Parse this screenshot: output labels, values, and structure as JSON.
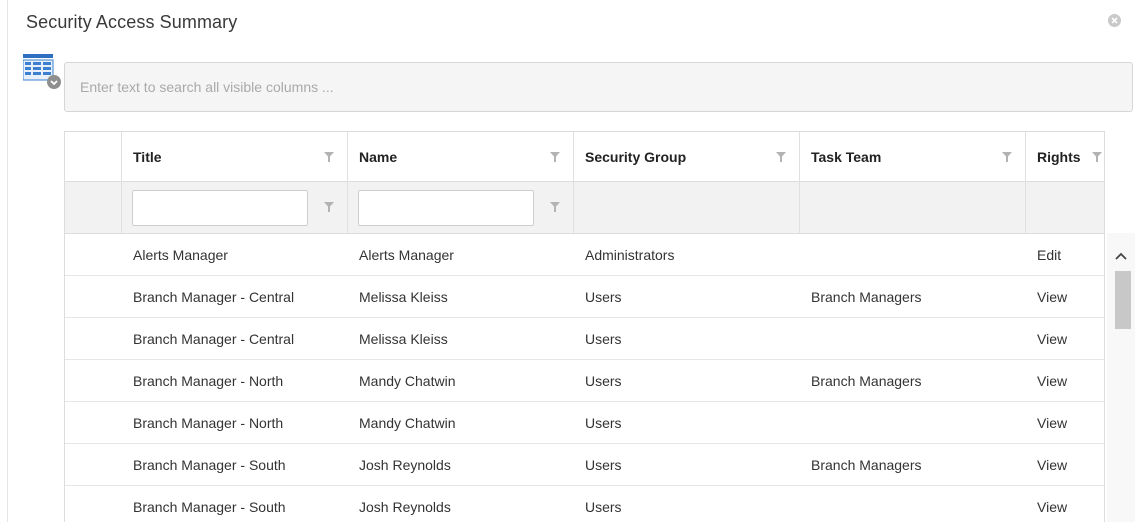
{
  "dialog": {
    "title": "Security Access Summary"
  },
  "search": {
    "placeholder": "Enter text to search all visible columns ..."
  },
  "grid": {
    "columns": [
      "Title",
      "Name",
      "Security Group",
      "Task Team",
      "Rights"
    ],
    "rows": [
      {
        "title": "Alerts Manager",
        "name": "Alerts Manager",
        "group": "Administrators",
        "team": "",
        "rights": "Edit"
      },
      {
        "title": "Branch Manager - Central",
        "name": "Melissa Kleiss",
        "group": "Users",
        "team": "Branch Managers",
        "rights": "View"
      },
      {
        "title": "Branch Manager - Central",
        "name": "Melissa Kleiss",
        "group": "Users",
        "team": "",
        "rights": "View"
      },
      {
        "title": "Branch Manager - North",
        "name": "Mandy Chatwin",
        "group": "Users",
        "team": "Branch Managers",
        "rights": "View"
      },
      {
        "title": "Branch Manager - North",
        "name": "Mandy Chatwin",
        "group": "Users",
        "team": "",
        "rights": "View"
      },
      {
        "title": "Branch Manager - South",
        "name": "Josh Reynolds",
        "group": "Users",
        "team": "Branch Managers",
        "rights": "View"
      },
      {
        "title": "Branch Manager - South",
        "name": "Josh Reynolds",
        "group": "Users",
        "team": "",
        "rights": "View"
      }
    ]
  },
  "icons": {
    "close": "close-icon",
    "grid_menu": "grid-menu-icon",
    "filter": "filter-icon",
    "scroll_up": "chevron-up-icon"
  },
  "colors": {
    "icon_blue": "#3d7fd0",
    "icon_gray": "#8f8f8f"
  }
}
